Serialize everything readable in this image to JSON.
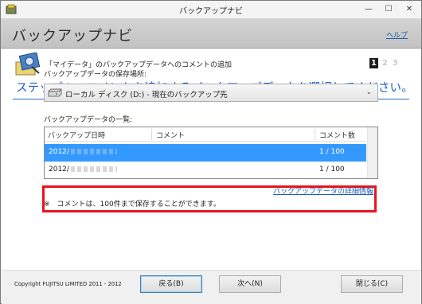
{
  "window": {
    "title": "バックアップナビ",
    "controls": {
      "minimize": "—",
      "maximize": "☐",
      "close": "✕"
    }
  },
  "header": {
    "title": "バックアップナビ",
    "help_link": "ヘルプ"
  },
  "step": {
    "caption": "「マイデータ」のバックアップデータへのコメントの追加",
    "indicators": [
      "1",
      "2",
      "3"
    ],
    "current": 1,
    "heading": "ステップ１…コメントを追加するバックアップデータを選択してください。"
  },
  "location": {
    "label": "バックアップデータの保存場所:",
    "value": "ローカル ディスク (D:) - 現在のバックアップ先",
    "arrow": "⌄"
  },
  "backup_list": {
    "label": "バックアップデータの一覧:",
    "columns": [
      "バックアップ日時",
      "コメント",
      "コメント数"
    ],
    "rows": [
      {
        "date": "2012/",
        "comment": "",
        "count": "1 / 100",
        "selected": true
      },
      {
        "date": "2012/",
        "comment": "",
        "count": "1 / 100",
        "selected": false
      }
    ]
  },
  "detail_link": "バックアップデータの詳細情報",
  "note": "※　コメントは、100件まで保存することができます。",
  "footer": {
    "copyright": "Copyright FUJITSU LIMITED 2011 - 2012",
    "back_button": "戻る(B)",
    "next_button": "次へ(N)",
    "close_button": "閉じる(C)"
  },
  "colors": {
    "accent": "#1a5ec4",
    "selection": "#3399ff",
    "highlight_border": "#e8141c",
    "header_bg": "#c8c8c8"
  }
}
